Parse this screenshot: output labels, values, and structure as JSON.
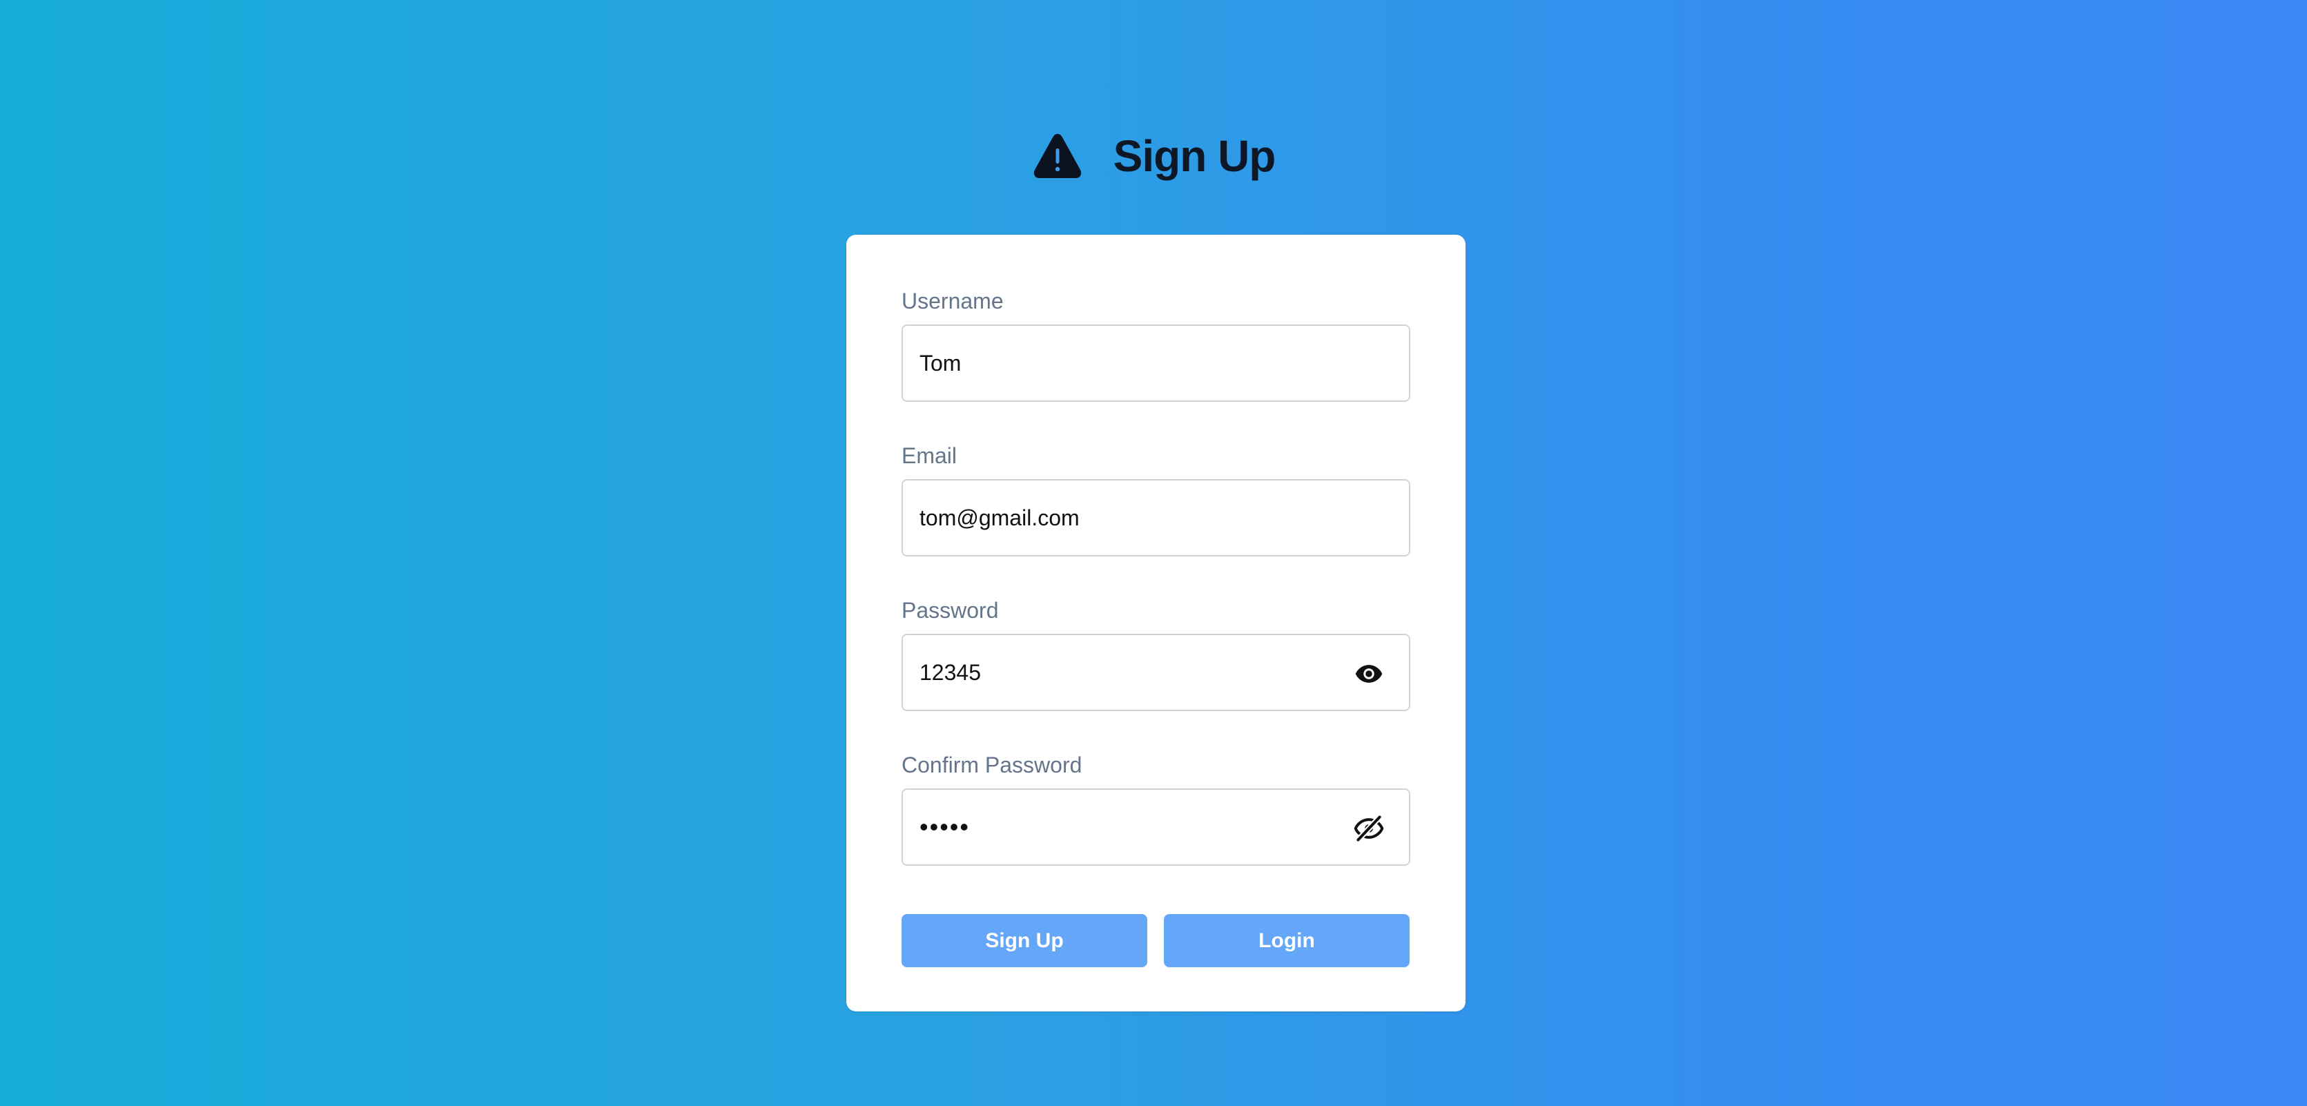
{
  "header": {
    "title": "Sign Up",
    "logo_icon": "warning-triangle-icon"
  },
  "form": {
    "username": {
      "label": "Username",
      "value": "Tom"
    },
    "email": {
      "label": "Email",
      "value": "tom@gmail.com"
    },
    "password": {
      "label": "Password",
      "value": "12345",
      "toggle_icon": "eye-icon",
      "visible": true
    },
    "confirm_password": {
      "label": "Confirm Password",
      "value": "•••••",
      "toggle_icon": "eye-slash-icon",
      "visible": false
    }
  },
  "buttons": {
    "signup_label": "Sign Up",
    "login_label": "Login"
  },
  "colors": {
    "background_start": "#17acd9",
    "background_end": "#3b87f4",
    "button": "#64a6f8",
    "title": "#0e1726",
    "label": "#64748b"
  }
}
